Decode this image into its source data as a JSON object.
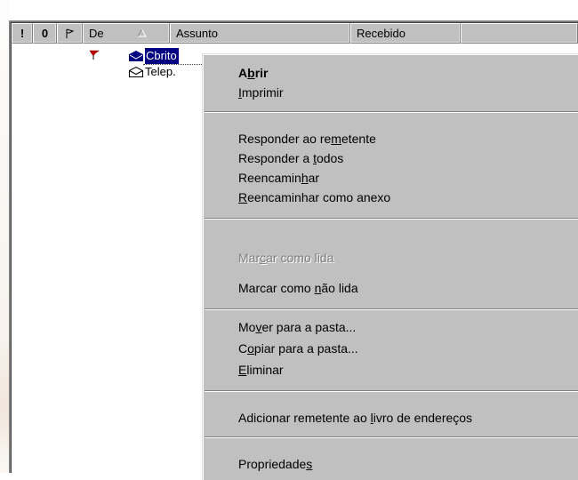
{
  "columns": {
    "importance": "!",
    "attachment": "0",
    "flag": "",
    "from": "De",
    "subject": "Assunto",
    "received": "Recebido"
  },
  "messages": [
    {
      "from": "Cbrito",
      "flagged": true,
      "selected": true,
      "icon": "envelope-closed-icon"
    },
    {
      "from": "Telep.",
      "flagged": false,
      "selected": false,
      "icon": "envelope-open-icon"
    }
  ],
  "context_menu": {
    "items": [
      {
        "pre": "A",
        "u": "b",
        "post": "rir",
        "bold": true,
        "enabled": true
      },
      {
        "pre": "",
        "u": "I",
        "post": "mprimir",
        "bold": false,
        "enabled": true
      },
      {
        "pre": "Responder ao re",
        "u": "m",
        "post": "etente",
        "bold": false,
        "enabled": true
      },
      {
        "pre": "Responder a ",
        "u": "t",
        "post": "odos",
        "bold": false,
        "enabled": true
      },
      {
        "pre": "Reencamin",
        "u": "h",
        "post": "ar",
        "bold": false,
        "enabled": true
      },
      {
        "pre": "",
        "u": "R",
        "post": "eencaminhar como anexo",
        "bold": false,
        "enabled": true
      },
      {
        "pre": "Mar",
        "u": "c",
        "post": "ar como lida",
        "bold": false,
        "enabled": false
      },
      {
        "pre": "Marcar como ",
        "u": "n",
        "post": "ão lida",
        "bold": false,
        "enabled": true
      },
      {
        "pre": "Mo",
        "u": "v",
        "post": "er para a pasta...",
        "bold": false,
        "enabled": true
      },
      {
        "pre": "C",
        "u": "o",
        "post": "piar para a pasta...",
        "bold": false,
        "enabled": true
      },
      {
        "pre": "",
        "u": "E",
        "post": "liminar",
        "bold": false,
        "enabled": true
      },
      {
        "pre": "Adicionar remetente ao ",
        "u": "l",
        "post": "ivro de endereços",
        "bold": false,
        "enabled": true
      },
      {
        "pre": "Propriedade",
        "u": "s",
        "post": "",
        "bold": false,
        "enabled": true
      }
    ]
  }
}
